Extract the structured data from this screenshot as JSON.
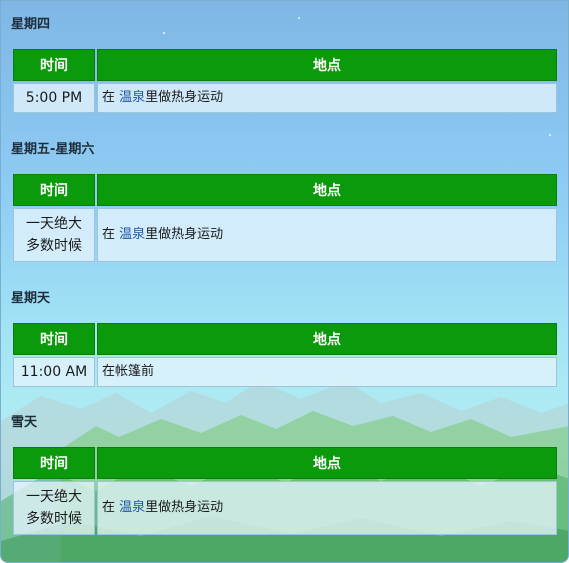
{
  "colors": {
    "header_green": "#0b9a0b",
    "link_blue": "#1f55a8"
  },
  "sections": [
    {
      "heading": "星期四",
      "col_time": "时间",
      "col_place": "地点",
      "rows": [
        {
          "time": "5:00 PM",
          "time_line2": "",
          "pre": "在 ",
          "link": "温泉",
          "post": "里做热身运动"
        }
      ]
    },
    {
      "heading": "星期五-星期六",
      "col_time": "时间",
      "col_place": "地点",
      "rows": [
        {
          "time": "一天绝大",
          "time_line2": "多数时候",
          "pre": "在 ",
          "link": "温泉",
          "post": "里做热身运动"
        }
      ]
    },
    {
      "heading": "星期天",
      "col_time": "时间",
      "col_place": "地点",
      "rows": [
        {
          "time": "11:00 AM",
          "time_line2": "",
          "pre": "在帐篷前",
          "link": "",
          "post": ""
        }
      ]
    },
    {
      "heading": "雪天",
      "col_time": "时间",
      "col_place": "地点",
      "rows": [
        {
          "time": "一天绝大",
          "time_line2": "多数时候",
          "pre": "在 ",
          "link": "温泉",
          "post": "里做热身运动"
        }
      ]
    }
  ]
}
